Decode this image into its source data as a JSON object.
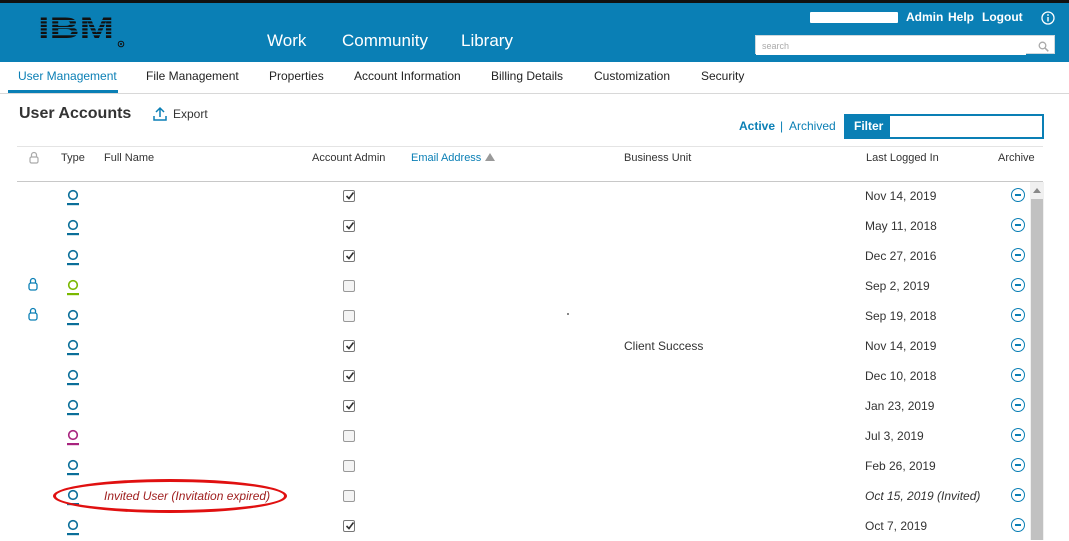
{
  "brand": {
    "logo": "IBM"
  },
  "top_nav": {
    "items": [
      "Work",
      "Community",
      "Library"
    ]
  },
  "utility_nav": {
    "admin": "Admin",
    "help": "Help",
    "logout": "Logout"
  },
  "search": {
    "placeholder": "search"
  },
  "tabs": [
    "User Management",
    "File Management",
    "Properties",
    "Account Information",
    "Billing Details",
    "Customization",
    "Security"
  ],
  "page": {
    "title": "User Accounts",
    "export_label": "Export"
  },
  "status_filter": {
    "active": "Active",
    "separator": "|",
    "archived": "Archived"
  },
  "filter": {
    "label": "Filter",
    "value": ""
  },
  "table": {
    "columns": {
      "type": "Type",
      "full_name": "Full Name",
      "account_admin": "Account Admin",
      "email": "Email Address",
      "business_unit": "Business Unit",
      "last_logged_in": "Last Logged In",
      "archive": "Archive"
    },
    "rows": [
      {
        "name": "",
        "admin": true,
        "business_unit": "",
        "last_login": "Nov 14, 2019",
        "locked": false,
        "type_color": "#0a6e99"
      },
      {
        "name": "",
        "admin": true,
        "business_unit": "",
        "last_login": "May 11, 2018",
        "locked": false,
        "type_color": "#0a6e99"
      },
      {
        "name": "",
        "admin": true,
        "business_unit": "",
        "last_login": "Dec 27, 2016",
        "locked": false,
        "type_color": "#0a6e99"
      },
      {
        "name": "",
        "admin": false,
        "business_unit": "",
        "last_login": "Sep 2, 2019",
        "locked": true,
        "type_color": "#7ab800"
      },
      {
        "name": "",
        "admin": false,
        "business_unit": "",
        "last_login": "Sep 19, 2018",
        "locked": true,
        "type_color": "#0a6e99"
      },
      {
        "name": "",
        "admin": true,
        "business_unit": "Client Success",
        "last_login": "Nov 14, 2019",
        "locked": false,
        "type_color": "#0a6e99"
      },
      {
        "name": "",
        "admin": true,
        "business_unit": "",
        "last_login": "Dec 10, 2018",
        "locked": false,
        "type_color": "#0a6e99"
      },
      {
        "name": "",
        "admin": true,
        "business_unit": "",
        "last_login": "Jan 23, 2019",
        "locked": false,
        "type_color": "#0a6e99"
      },
      {
        "name": "",
        "admin": false,
        "business_unit": "",
        "last_login": "Jul 3, 2019",
        "locked": false,
        "type_color": "#a8237e"
      },
      {
        "name": "",
        "admin": false,
        "business_unit": "",
        "last_login": "Feb 26, 2019",
        "locked": false,
        "type_color": "#0a6e99"
      },
      {
        "name": "Invited User (Invitation expired)",
        "admin": false,
        "business_unit": "",
        "last_login": "Oct 15, 2019 (Invited)",
        "locked": false,
        "type_color": "#0a6e99",
        "invited": true
      },
      {
        "name": "",
        "admin": true,
        "business_unit": "",
        "last_login": "Oct 7, 2019",
        "locked": false,
        "type_color": "#0a6e99"
      }
    ]
  },
  "colors": {
    "brand_blue": "#0a7fb5",
    "highlight_red": "#e01010"
  }
}
